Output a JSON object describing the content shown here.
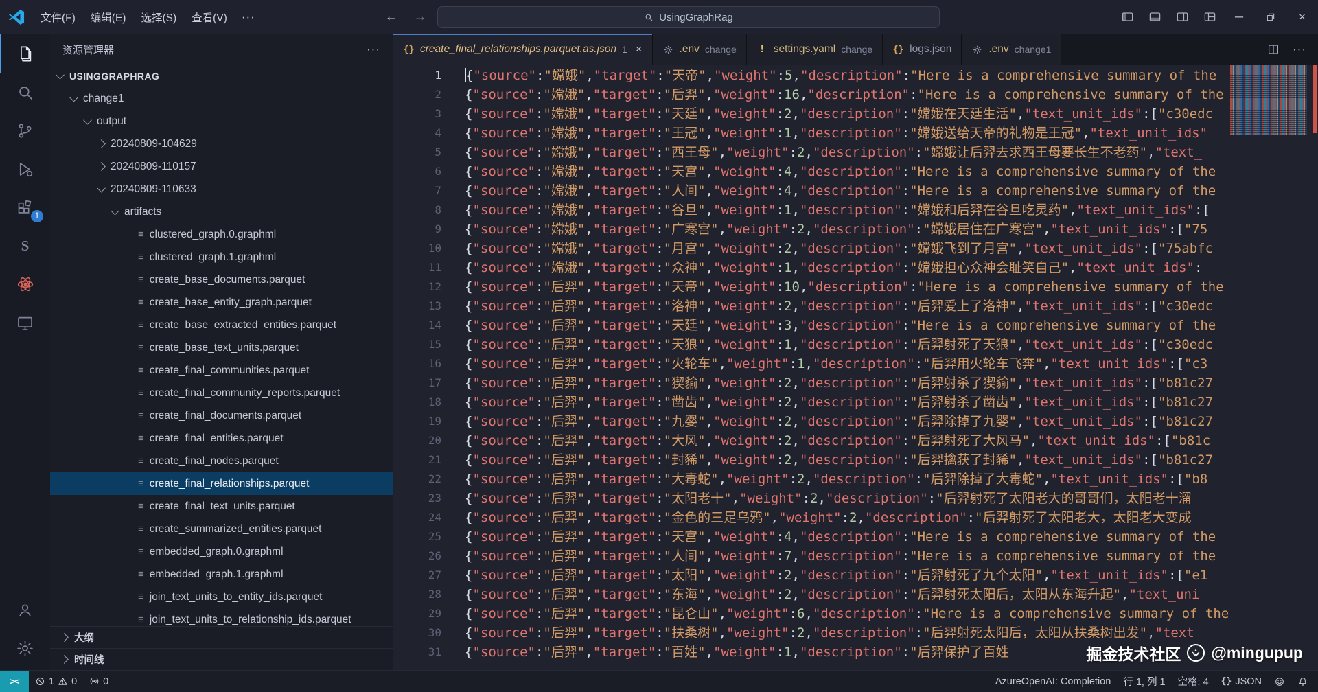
{
  "titlebar": {
    "menus": [
      "文件(F)",
      "编辑(E)",
      "选择(S)",
      "查看(V)"
    ],
    "more": "···",
    "search_value": "UsingGraphRag",
    "minimize": "─",
    "close": "×"
  },
  "activity_bar": {
    "extensions_badge": "1",
    "s_extension_glyph": "S"
  },
  "sidebar": {
    "title": "资源管理器",
    "more": "···",
    "tree": [
      {
        "label": "USINGGRAPHRAG",
        "indent": 0,
        "chevron": "down",
        "kind": "root"
      },
      {
        "label": "change1",
        "indent": 1,
        "chevron": "down",
        "kind": "folder"
      },
      {
        "label": "output",
        "indent": 2,
        "chevron": "down",
        "kind": "folder"
      },
      {
        "label": "20240809-104629",
        "indent": 3,
        "chevron": "right",
        "kind": "folder"
      },
      {
        "label": "20240809-110157",
        "indent": 3,
        "chevron": "right",
        "kind": "folder"
      },
      {
        "label": "20240809-110633",
        "indent": 3,
        "chevron": "down",
        "kind": "folder"
      },
      {
        "label": "artifacts",
        "indent": 4,
        "chevron": "down",
        "kind": "folder"
      },
      {
        "label": "clustered_graph.0.graphml",
        "indent": 5,
        "kind": "file"
      },
      {
        "label": "clustered_graph.1.graphml",
        "indent": 5,
        "kind": "file"
      },
      {
        "label": "create_base_documents.parquet",
        "indent": 5,
        "kind": "file"
      },
      {
        "label": "create_base_entity_graph.parquet",
        "indent": 5,
        "kind": "file"
      },
      {
        "label": "create_base_extracted_entities.parquet",
        "indent": 5,
        "kind": "file"
      },
      {
        "label": "create_base_text_units.parquet",
        "indent": 5,
        "kind": "file"
      },
      {
        "label": "create_final_communities.parquet",
        "indent": 5,
        "kind": "file"
      },
      {
        "label": "create_final_community_reports.parquet",
        "indent": 5,
        "kind": "file"
      },
      {
        "label": "create_final_documents.parquet",
        "indent": 5,
        "kind": "file"
      },
      {
        "label": "create_final_entities.parquet",
        "indent": 5,
        "kind": "file"
      },
      {
        "label": "create_final_nodes.parquet",
        "indent": 5,
        "kind": "file"
      },
      {
        "label": "create_final_relationships.parquet",
        "indent": 5,
        "kind": "file",
        "selected": true
      },
      {
        "label": "create_final_text_units.parquet",
        "indent": 5,
        "kind": "file"
      },
      {
        "label": "create_summarized_entities.parquet",
        "indent": 5,
        "kind": "file"
      },
      {
        "label": "embedded_graph.0.graphml",
        "indent": 5,
        "kind": "file"
      },
      {
        "label": "embedded_graph.1.graphml",
        "indent": 5,
        "kind": "file"
      },
      {
        "label": "join_text_units_to_entity_ids.parquet",
        "indent": 5,
        "kind": "file"
      },
      {
        "label": "join_text_units_to_relationship_ids.parquet",
        "indent": 5,
        "kind": "file"
      }
    ],
    "sections_bottom": [
      {
        "label": "大纲"
      },
      {
        "label": "时间线"
      }
    ]
  },
  "tabs": [
    {
      "icon": "braces",
      "label": "create_final_relationships.parquet.as.json",
      "badge": "1",
      "active": true,
      "mod": true,
      "italic": true,
      "closable": true
    },
    {
      "icon": "gear",
      "label": ".env",
      "desc": "change",
      "mod": true
    },
    {
      "icon": "exclaim",
      "label": "settings.yaml",
      "desc": "change",
      "mod": true
    },
    {
      "icon": "braces",
      "label": "logs.json"
    },
    {
      "icon": "gear",
      "label": ".env",
      "desc": "change1",
      "mod": true
    }
  ],
  "tabbar_more": "···",
  "editor": {
    "keys": [
      "source",
      "target",
      "weight",
      "description"
    ],
    "lines": [
      {
        "s": "嫦娥",
        "t": "天帝",
        "w": 5,
        "d": "\"Here is a comprehensive summary of the"
      },
      {
        "s": "嫦娥",
        "t": "后羿",
        "w": 16,
        "d": "\"Here is a comprehensive summary of the"
      },
      {
        "s": "嫦娥",
        "t": "天廷",
        "w": 2,
        "d": "\"嫦娥在天廷生活\"",
        "tail": [
          [
            "p",
            ","
          ],
          [
            "k",
            "\"text_unit_ids\""
          ],
          [
            "p",
            ":["
          ],
          [
            "s",
            "\"c30edc"
          ]
        ]
      },
      {
        "s": "嫦娥",
        "t": "王冠",
        "w": 1,
        "d": "\"嫦娥送给天帝的礼物是王冠\"",
        "tail": [
          [
            "p",
            ","
          ],
          [
            "k",
            "\"text_unit_ids\""
          ]
        ]
      },
      {
        "s": "嫦娥",
        "t": "西王母",
        "w": 2,
        "d": "\"嫦娥让后羿去求西王母要长生不老药\"",
        "tail": [
          [
            "p",
            ","
          ],
          [
            "k",
            "\"text_"
          ]
        ]
      },
      {
        "s": "嫦娥",
        "t": "天宫",
        "w": 4,
        "d": "\"Here is a comprehensive summary of the"
      },
      {
        "s": "嫦娥",
        "t": "人间",
        "w": 4,
        "d": "\"Here is a comprehensive summary of the"
      },
      {
        "s": "嫦娥",
        "t": "谷旦",
        "w": 1,
        "d": "\"嫦娥和后羿在谷旦吃灵药\"",
        "tail": [
          [
            "p",
            ","
          ],
          [
            "k",
            "\"text_unit_ids\""
          ],
          [
            "p",
            ":["
          ]
        ]
      },
      {
        "s": "嫦娥",
        "t": "广寒宫",
        "w": 2,
        "d": "\"嫦娥居住在广寒宫\"",
        "tail": [
          [
            "p",
            ","
          ],
          [
            "k",
            "\"text_unit_ids\""
          ],
          [
            "p",
            ":["
          ],
          [
            "s",
            "\"75"
          ]
        ]
      },
      {
        "s": "嫦娥",
        "t": "月宫",
        "w": 2,
        "d": "\"嫦娥飞到了月宫\"",
        "tail": [
          [
            "p",
            ","
          ],
          [
            "k",
            "\"text_unit_ids\""
          ],
          [
            "p",
            ":["
          ],
          [
            "s",
            "\"75abfc"
          ]
        ]
      },
      {
        "s": "嫦娥",
        "t": "众神",
        "w": 1,
        "d": "\"嫦娥担心众神会耻笑自己\"",
        "tail": [
          [
            "p",
            ","
          ],
          [
            "k",
            "\"text_unit_ids\""
          ],
          [
            "p",
            ":"
          ]
        ]
      },
      {
        "s": "后羿",
        "t": "天帝",
        "w": 10,
        "d": "\"Here is a comprehensive summary of the"
      },
      {
        "s": "后羿",
        "t": "洛神",
        "w": 2,
        "d": "\"后羿爱上了洛神\"",
        "tail": [
          [
            "p",
            ","
          ],
          [
            "k",
            "\"text_unit_ids\""
          ],
          [
            "p",
            ":["
          ],
          [
            "s",
            "\"c30edc"
          ]
        ]
      },
      {
        "s": "后羿",
        "t": "天廷",
        "w": 3,
        "d": "\"Here is a comprehensive summary of the"
      },
      {
        "s": "后羿",
        "t": "天狼",
        "w": 1,
        "d": "\"后羿射死了天狼\"",
        "tail": [
          [
            "p",
            ","
          ],
          [
            "k",
            "\"text_unit_ids\""
          ],
          [
            "p",
            ":["
          ],
          [
            "s",
            "\"c30edc"
          ]
        ]
      },
      {
        "s": "后羿",
        "t": "火轮车",
        "w": 1,
        "d": "\"后羿用火轮车飞奔\"",
        "tail": [
          [
            "p",
            ","
          ],
          [
            "k",
            "\"text_unit_ids\""
          ],
          [
            "p",
            ":["
          ],
          [
            "s",
            "\"c3"
          ]
        ]
      },
      {
        "s": "后羿",
        "t": "猰貐",
        "w": 2,
        "d": "\"后羿射杀了猰貐\"",
        "tail": [
          [
            "p",
            ","
          ],
          [
            "k",
            "\"text_unit_ids\""
          ],
          [
            "p",
            ":["
          ],
          [
            "s",
            "\"b81c27"
          ]
        ]
      },
      {
        "s": "后羿",
        "t": "凿齿",
        "w": 2,
        "d": "\"后羿射杀了凿齿\"",
        "tail": [
          [
            "p",
            ","
          ],
          [
            "k",
            "\"text_unit_ids\""
          ],
          [
            "p",
            ":["
          ],
          [
            "s",
            "\"b81c27"
          ]
        ]
      },
      {
        "s": "后羿",
        "t": "九婴",
        "w": 2,
        "d": "\"后羿除掉了九婴\"",
        "tail": [
          [
            "p",
            ","
          ],
          [
            "k",
            "\"text_unit_ids\""
          ],
          [
            "p",
            ":["
          ],
          [
            "s",
            "\"b81c27"
          ]
        ]
      },
      {
        "s": "后羿",
        "t": "大风",
        "w": 2,
        "d": "\"后羿射死了大风马\"",
        "tail": [
          [
            "p",
            ","
          ],
          [
            "k",
            "\"text_unit_ids\""
          ],
          [
            "p",
            ":["
          ],
          [
            "s",
            "\"b81c"
          ]
        ]
      },
      {
        "s": "后羿",
        "t": "封豨",
        "w": 2,
        "d": "\"后羿擒获了封豨\"",
        "tail": [
          [
            "p",
            ","
          ],
          [
            "k",
            "\"text_unit_ids\""
          ],
          [
            "p",
            ":["
          ],
          [
            "s",
            "\"b81c27"
          ]
        ]
      },
      {
        "s": "后羿",
        "t": "大毒蛇",
        "w": 2,
        "d": "\"后羿除掉了大毒蛇\"",
        "tail": [
          [
            "p",
            ","
          ],
          [
            "k",
            "\"text_unit_ids\""
          ],
          [
            "p",
            ":["
          ],
          [
            "s",
            "\"b8"
          ]
        ]
      },
      {
        "s": "后羿",
        "t": "太阳老十",
        "w": 2,
        "d": "\"后羿射死了太阳老大的哥哥们，太阳老十溜"
      },
      {
        "s": "后羿",
        "t": "金色的三足乌鸦",
        "w": 2,
        "d": "\"后羿射死了太阳老大，太阳老大变成"
      },
      {
        "s": "后羿",
        "t": "天宫",
        "w": 4,
        "d": "\"Here is a comprehensive summary of the"
      },
      {
        "s": "后羿",
        "t": "人间",
        "w": 7,
        "d": "\"Here is a comprehensive summary of the"
      },
      {
        "s": "后羿",
        "t": "太阳",
        "w": 2,
        "d": "\"后羿射死了九个太阳\"",
        "tail": [
          [
            "p",
            ","
          ],
          [
            "k",
            "\"text_unit_ids\""
          ],
          [
            "p",
            ":["
          ],
          [
            "s",
            "\"e1"
          ]
        ]
      },
      {
        "s": "后羿",
        "t": "东海",
        "w": 2,
        "d": "\"后羿射死太阳后，太阳从东海升起\"",
        "tail": [
          [
            "p",
            ","
          ],
          [
            "k",
            "\"text_uni"
          ]
        ]
      },
      {
        "s": "后羿",
        "t": "昆仑山",
        "w": 6,
        "d": "\"Here is a comprehensive summary of the"
      },
      {
        "s": "后羿",
        "t": "扶桑树",
        "w": 2,
        "d": "\"后羿射死太阳后，太阳从扶桑树出发\"",
        "tail": [
          [
            "p",
            ","
          ],
          [
            "k",
            "\"text"
          ]
        ]
      },
      {
        "s": "后羿",
        "t": "百姓",
        "w": 1,
        "d": "\"后羿保护了百姓"
      }
    ]
  },
  "status_bar": {
    "remote": "><",
    "problems": {
      "errors": "1",
      "warnings": "0"
    },
    "ports": "0",
    "azure": "AzureOpenAI: Completion",
    "cursor": "行 1, 列 1",
    "spaces": "空格: 4",
    "lang_icon": "{}",
    "lang": "JSON"
  },
  "watermark": {
    "text1": "掘金技术社区",
    "text2": "@mingupup"
  }
}
